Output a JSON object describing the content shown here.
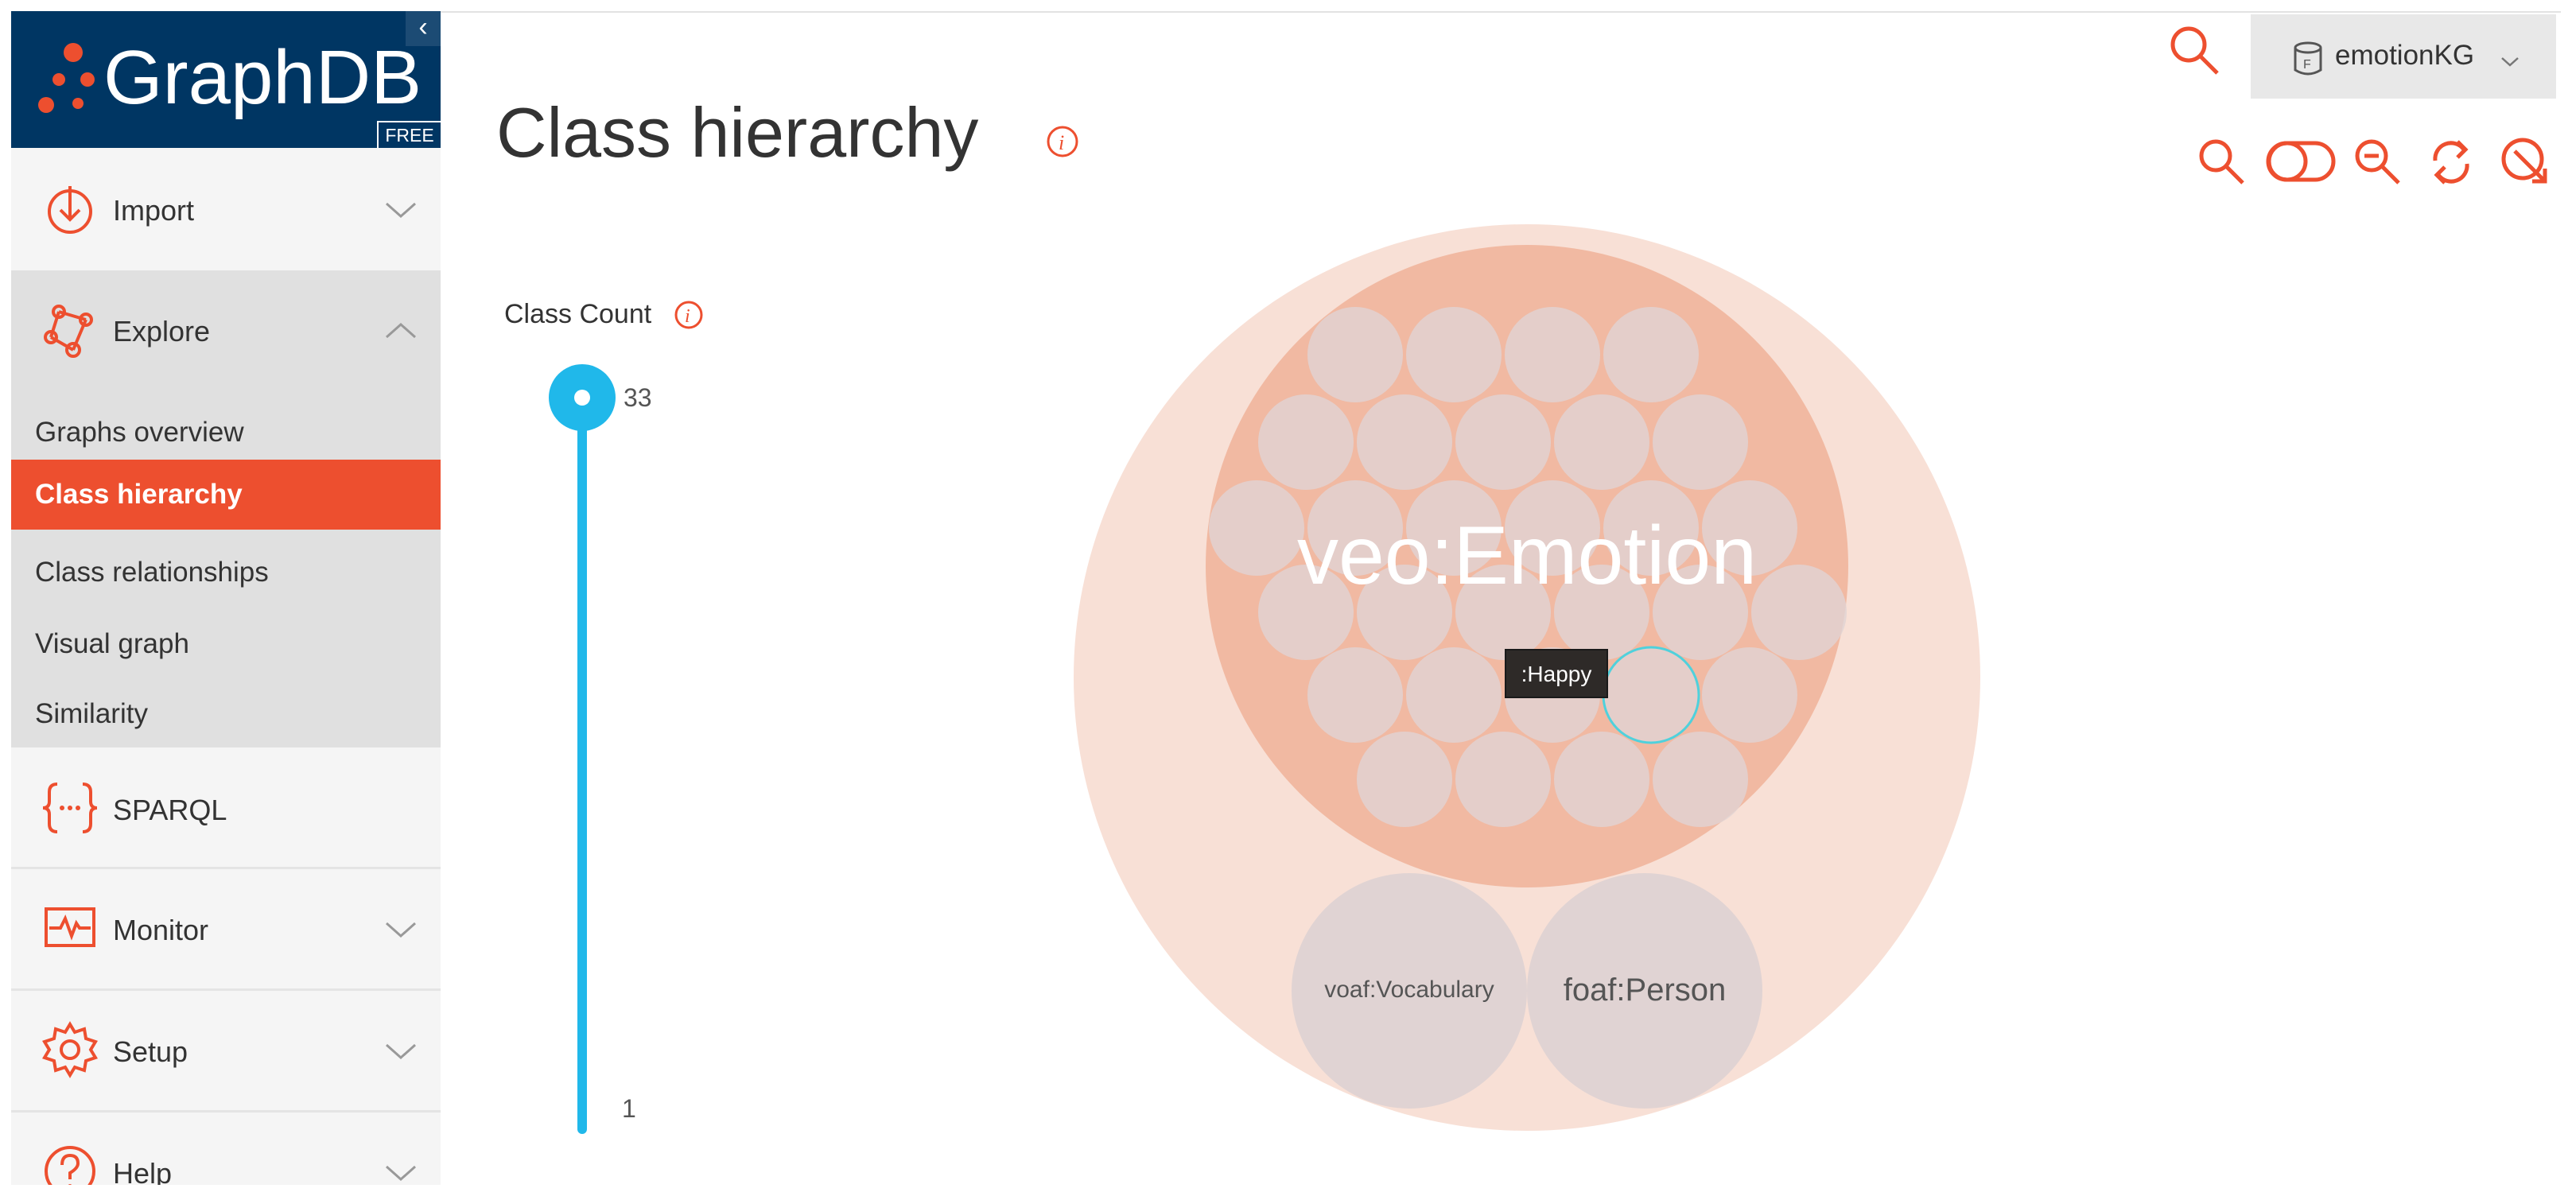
{
  "app": {
    "logo_text": "GraphDB",
    "edition_badge": "FREE"
  },
  "sidebar": {
    "items": [
      {
        "label": "Import",
        "icon": "import-icon",
        "expanded": false
      },
      {
        "label": "Explore",
        "icon": "explore-icon",
        "expanded": true
      },
      {
        "label": "SPARQL",
        "icon": "sparql-icon"
      },
      {
        "label": "Monitor",
        "icon": "monitor-icon",
        "expanded": false
      },
      {
        "label": "Setup",
        "icon": "setup-icon",
        "expanded": false
      },
      {
        "label": "Help",
        "icon": "help-icon",
        "expanded": false
      }
    ],
    "explore_subitems": [
      "Graphs overview",
      "Class hierarchy",
      "Class relationships",
      "Visual graph",
      "Similarity"
    ],
    "active_subitem": "Class hierarchy"
  },
  "header": {
    "repository": "emotionKG"
  },
  "page": {
    "title": "Class hierarchy"
  },
  "toolbar": {
    "tools": [
      "search-icon",
      "toggle-icon",
      "zoom-out-icon",
      "refresh-icon",
      "download-icon"
    ]
  },
  "class_count": {
    "label": "Class Count",
    "max": "33",
    "min": "1",
    "value": 33
  },
  "hierarchy": {
    "root_label": "",
    "emotion_label": "veo:Emotion",
    "child_classes": [
      "voaf:Vocabulary",
      "foaf:Person"
    ],
    "emotion_subclass_count": 31,
    "hovered": ":Happy"
  },
  "colors": {
    "accent": "#ed4f2f",
    "logo_bg": "#003663",
    "slider": "#20b8ea",
    "outer_circle": "#f8e0d6",
    "emotion_circle": "#f1b9a2",
    "leaf_circle": "#e0d3d3"
  }
}
